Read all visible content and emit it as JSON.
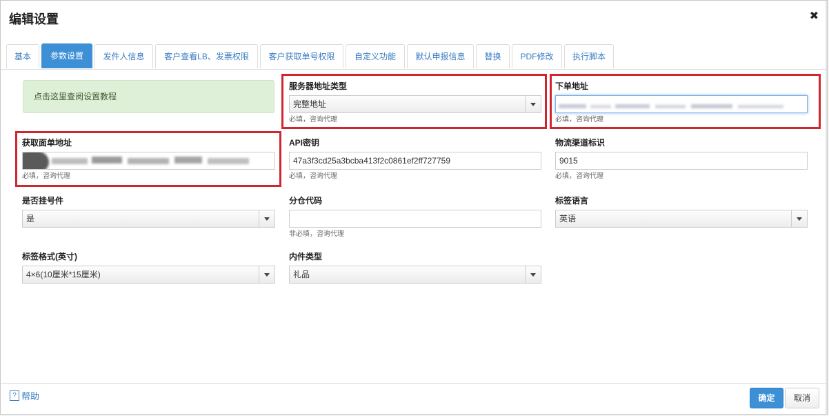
{
  "dialog": {
    "title": "编辑设置",
    "close_glyph": "✖"
  },
  "tabs": [
    {
      "label": "基本",
      "active": false
    },
    {
      "label": "参数设置",
      "active": true
    },
    {
      "label": "发件人信息",
      "active": false
    },
    {
      "label": "客户查看LB、发票权限",
      "active": false
    },
    {
      "label": "客户获取单号权限",
      "active": false
    },
    {
      "label": "自定义功能",
      "active": false
    },
    {
      "label": "默认申报信息",
      "active": false
    },
    {
      "label": "替换",
      "active": false
    },
    {
      "label": "PDF修改",
      "active": false
    },
    {
      "label": "执行脚本",
      "active": false
    }
  ],
  "hint": {
    "text": "点击这里查阅设置教程"
  },
  "fields": {
    "server_type": {
      "label": "服务器地址类型",
      "value": "完整地址",
      "help": "必填，咨询代理"
    },
    "order_url": {
      "label": "下单地址",
      "value": "",
      "help": "必填，咨询代理"
    },
    "label_url": {
      "label": "获取面单地址",
      "value": "",
      "help": "必填，咨询代理"
    },
    "api_key": {
      "label": "API密钥",
      "value": "47a3f3cd25a3bcba413f2c0861ef2ff727759",
      "help": "必填，咨询代理"
    },
    "channel_code": {
      "label": "物流渠道标识",
      "value": "9015",
      "help": "必填，咨询代理"
    },
    "registered": {
      "label": "是否挂号件",
      "value": "是"
    },
    "warehouse_code": {
      "label": "分仓代码",
      "value": "",
      "help": "非必填，咨询代理"
    },
    "label_language": {
      "label": "标签语言",
      "value": "英语"
    },
    "label_format": {
      "label": "标签格式(英寸)",
      "value": "4×6(10厘米*15厘米)"
    },
    "content_type": {
      "label": "内件类型",
      "value": "礼品"
    }
  },
  "footer": {
    "help_icon_glyph": "?",
    "help_label": "帮助",
    "ok_label": "确定",
    "cancel_label": "取消"
  },
  "colors": {
    "accent": "#3d8fd6",
    "highlight_border": "#d0262e",
    "hint_bg": "#dff0d8"
  }
}
